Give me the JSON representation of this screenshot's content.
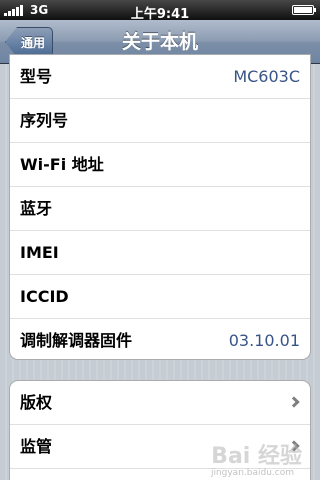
{
  "status_bar": {
    "network": "3G",
    "time": "上午9:41",
    "battery_level": 1.0
  },
  "nav": {
    "back_label": "通用",
    "title": "关于本机"
  },
  "about_rows": [
    {
      "label": "型号",
      "value": "MC603C"
    },
    {
      "label": "序列号",
      "value": ""
    },
    {
      "label": "Wi-Fi 地址",
      "value": ""
    },
    {
      "label": "蓝牙",
      "value": ""
    },
    {
      "label": "IMEI",
      "value": ""
    },
    {
      "label": "ICCID",
      "value": ""
    },
    {
      "label": "调制解调器固件",
      "value": "03.10.01"
    }
  ],
  "legal_rows": [
    {
      "label": "版权"
    },
    {
      "label": "监管"
    }
  ],
  "watermark": {
    "text": "Bai 经验",
    "url": "jingyan.baidu.com"
  }
}
